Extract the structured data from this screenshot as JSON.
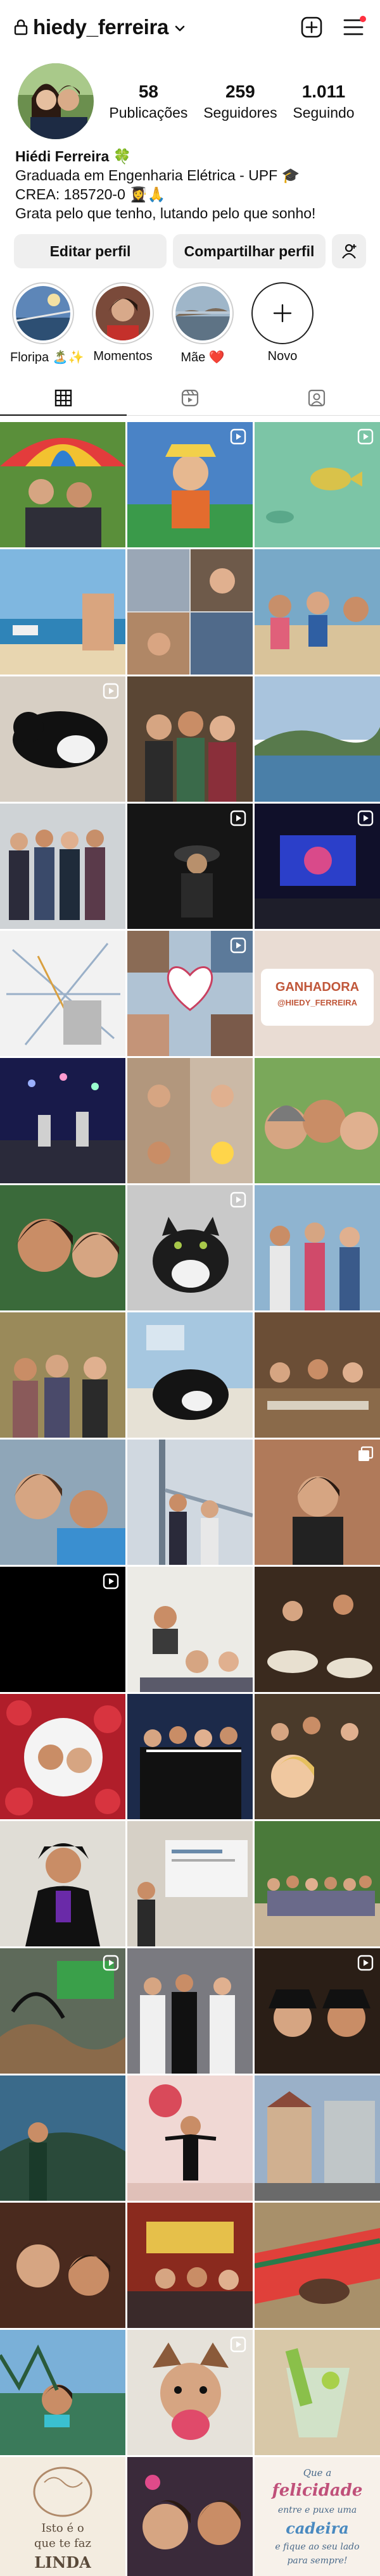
{
  "header": {
    "username": "hiedy_ferreira"
  },
  "profile": {
    "stats": [
      {
        "value": "58",
        "label": "Publicações"
      },
      {
        "value": "259",
        "label": "Seguidores"
      },
      {
        "value": "1.011",
        "label": "Seguindo"
      }
    ],
    "name": "Hiédi Ferreira 🍀",
    "bio_lines": [
      "Graduada em Engenharia Elétrica - UPF 🎓",
      "CREA: 185720-0 👩‍🎓🙏",
      "Grata pelo que tenho, lutando pelo que sonho!"
    ]
  },
  "actions": {
    "edit": "Editar perfil",
    "share": "Compartilhar perfil"
  },
  "highlights": [
    {
      "label": "Floripa 🏝️✨"
    },
    {
      "label": "Momentos"
    },
    {
      "label": "Mãe ❤️"
    },
    {
      "label": "Novo"
    }
  ],
  "grid_texts": {
    "ganhadora_title": "GANHADORA",
    "ganhadora_handle": "@HIEDY_FERREIRA",
    "quote1_a": "Isto é o",
    "quote1_b": "que te faz",
    "quote1_c": "LINDA",
    "quote2_a": "Que a",
    "quote2_b": "felicidade",
    "quote2_c": "entre e puxe uma",
    "quote2_d": "cadeira",
    "quote2_e": "e fique ao seu lado",
    "quote2_f": "para sempre!"
  },
  "colors": {
    "notification": "#ff3040",
    "button_bg": "#efefef"
  }
}
